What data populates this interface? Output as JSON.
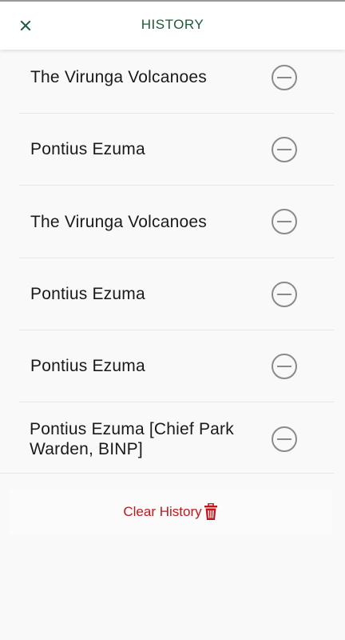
{
  "header": {
    "title": "HISTORY",
    "close_icon": "close-icon"
  },
  "history": {
    "items": [
      {
        "label": "The Virunga Volcanoes"
      },
      {
        "label": "Pontius Ezuma"
      },
      {
        "label": "The Virunga Volcanoes"
      },
      {
        "label": "Pontius Ezuma"
      },
      {
        "label": "Pontius Ezuma"
      },
      {
        "label": "Pontius Ezuma [Chief Park Warden, BINP]"
      }
    ],
    "remove_icon": "minus-circle-icon"
  },
  "footer": {
    "clear_label": "Clear History",
    "trash_icon": "trash-icon"
  },
  "colors": {
    "accent_green": "#1e5a3a",
    "danger_red": "#c0171c",
    "icon_grey": "#8a8a8a"
  }
}
